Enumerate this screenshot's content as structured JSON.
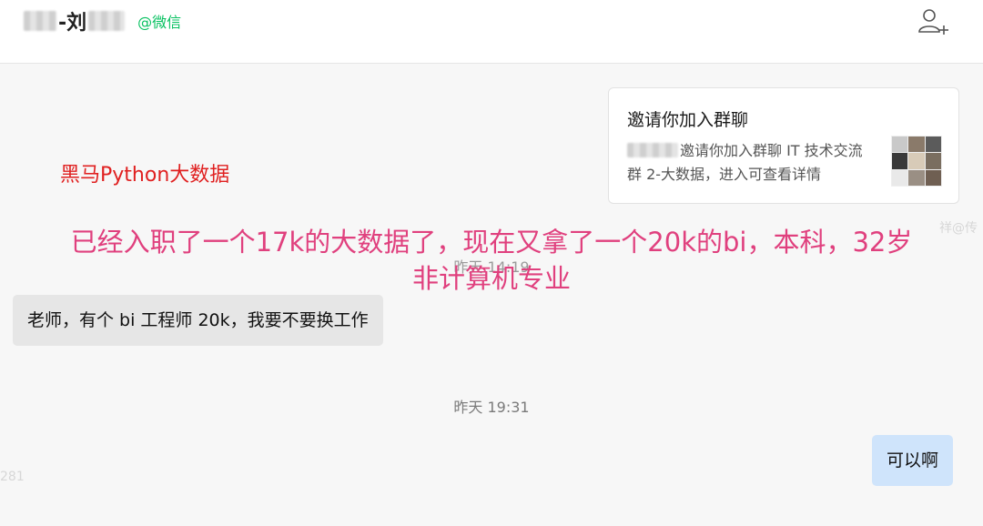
{
  "header": {
    "contact_name_part1": "-刘",
    "contact_tag": "@微信"
  },
  "invite_card": {
    "title": "邀请你加入群聊",
    "description": "邀请你加入群聊 IT 技术交流群 2-大数据，进入可查看详情"
  },
  "overlays": {
    "red_label": "黑马Python大数据",
    "pink_line1": "已经入职了一个17k的大数据了，现在又拿了一个20k的bi，本科，32岁",
    "pink_line2": "非计算机专业"
  },
  "messages": {
    "hidden_timestamp": "昨天 14:19",
    "received_text": "老师，有个 bi 工程师 20k，我要不要换工作",
    "timestamp": "昨天 19:31",
    "sent_text": "可以啊"
  },
  "watermarks": {
    "right_edge": "祥@传",
    "left_edge": "281"
  },
  "colors": {
    "tag_green": "#07c160",
    "sent_bubble": "#cfe4fb",
    "received_bubble": "#e6e6e6",
    "overlay_red": "#e02020",
    "overlay_pink": "#e0407e"
  },
  "icons": {
    "add_user": "add-user-icon",
    "group_avatar": "group-avatar-icon"
  }
}
